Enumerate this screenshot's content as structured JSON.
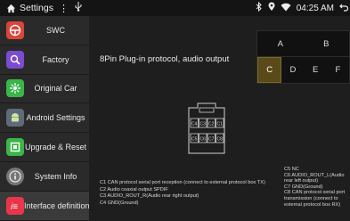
{
  "statusbar": {
    "title": "Settings",
    "time": "04:25 AM",
    "icons": [
      "home-icon",
      "more-vert-icon",
      "usb-icon",
      "bluetooth-icon",
      "location-icon",
      "wifi-icon",
      "back-icon"
    ]
  },
  "sidebar": {
    "items": [
      {
        "label": "SWC",
        "icon": "steering-wheel-icon",
        "color": "#d9453a"
      },
      {
        "label": "Factory",
        "icon": "factory-icon",
        "color": "#7b4bd1"
      },
      {
        "label": "Original Car",
        "icon": "original-car-icon",
        "color": "#3bb54a"
      },
      {
        "label": "Android Settings",
        "icon": "android-icon",
        "color": "#5f6b78"
      },
      {
        "label": "Upgrade & Reset",
        "icon": "upgrade-icon",
        "color": "#3bb54a"
      },
      {
        "label": "System Info",
        "icon": "info-icon",
        "color": "#777777"
      },
      {
        "label": "Interface definition",
        "icon": "interface-icon",
        "color": "#e8354a"
      }
    ]
  },
  "main": {
    "heading": "8Pin Plug-in protocol, audio output",
    "tabs_row1": [
      "A",
      "B"
    ],
    "tabs_row2": [
      "C",
      "D",
      "E",
      "F"
    ],
    "selected_tab": "C",
    "selected_color": "#5a4a18",
    "connector_pins_top": [
      "C4",
      "C3",
      "C2",
      "C1"
    ],
    "connector_pins_bottom": [
      "C5",
      "C6",
      "C7",
      "C8"
    ],
    "pins_left": [
      "C1 CAN protocol serial port reception (connect to external protocol box TX)",
      "C2 Audio coaxial output SPDIF",
      "C3 AUDIO_ROUT_R(Audio rear right output)",
      "C4 GND(Ground)"
    ],
    "pins_right": [
      "C5 NC",
      "C6 AUDIO_ROUT_L(Audio rear left output)",
      "C7 GND(Ground)",
      "C8 CAN protocol serial port transmission (connect to external protocol box RX)"
    ]
  }
}
